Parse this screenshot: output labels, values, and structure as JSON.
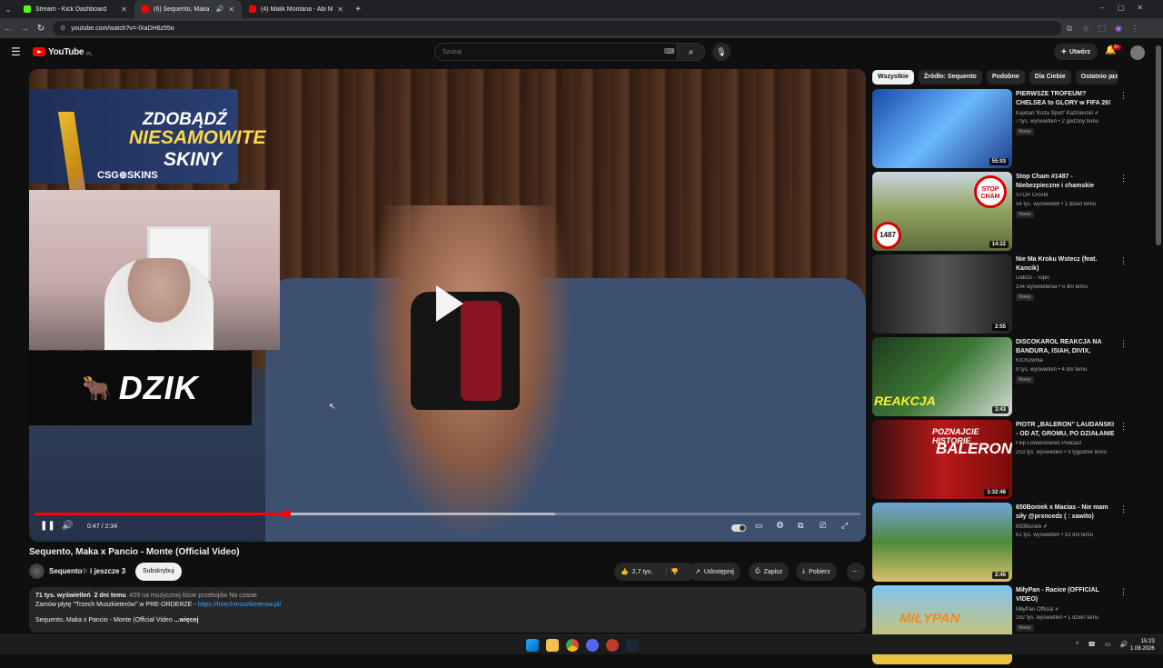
{
  "browser": {
    "tabs": [
      {
        "title": "Stream - Kick Dashboard",
        "favicon_color": "#53fc18",
        "active": false
      },
      {
        "title": "(6) Sequento, Maka x Panc",
        "favicon_color": "#ff0000",
        "active": true
      },
      {
        "title": "(4) Malik Montana - Abi Mosa",
        "favicon_color": "#ff0000",
        "active": false
      }
    ],
    "new_tab": "+",
    "url": "youtube.com/watch?v=-lXaDH6z55o"
  },
  "header": {
    "logo_text": "YouTube",
    "logo_region": "PL",
    "search_placeholder": "Szukaj",
    "create_label": "Utwórz",
    "notif_count": "9+"
  },
  "player": {
    "ad": {
      "line1": "ZDOBĄDŹ",
      "line2": "NIESAMOWITE",
      "line3": "SKINY",
      "brand": "CSG⊕SKINS"
    },
    "sponsor": "DZIK",
    "time": "0:47 / 2:34",
    "progress_fraction": 0.305,
    "buffered_fraction": 0.63
  },
  "video": {
    "title": "Sequento, Maka x Pancio - Monte (Official Video)",
    "channel": "Sequento",
    "channel_more": "i jeszcze 3",
    "subscribe_label": "Subskrybuj",
    "likes": "2,7 tys.",
    "share_label": "Udostępnij",
    "save_label": "Zapisz",
    "download_label": "Pobierz",
    "desc_views": "71 tys. wyświetleń",
    "desc_date": "2 dni temu",
    "desc_tags": "#29 na muzycznej liście przebojów Na czasie",
    "desc_line2_prefix": "Zamów płytę \"Trzech Muszkieterów\" w PRE-ORDERZE - ",
    "desc_link": "https://trzechmuszkieterow.pl/",
    "desc_line3": "Sequento, Maka x Pancio - Monte (Official Video",
    "desc_more": "...więcej"
  },
  "chips": [
    "Wszystkie",
    "Źródło: Sequento",
    "Podobne",
    "Dla Ciebie",
    "Ostatnio prz"
  ],
  "recommendations": [
    {
      "title": "PIERWSZE TROFEUM? CHELSEA to GLORY w FIFA 26!",
      "channel": "Kajetan 'Koza Sport' Kaźmierski ✔",
      "meta": "7 tys. wyświetleń • 2 godziny temu",
      "badge": "Nowy",
      "duration": "55:03",
      "thumb_bg": "linear-gradient(135deg,#1a4aa8,#6bb8ff,#1d3f8c)"
    },
    {
      "title": "Stop Cham #1487 - Niebezpieczne i chamskie sytuacje na drogach",
      "channel": "STOP CHAM",
      "meta": "54 tys. wyświetleń • 1 dzień temu",
      "badge": "Nowy",
      "duration": "14:22",
      "thumb_bg": "linear-gradient(180deg,#c9d6e0,#8fa35e,#5d6b3b)"
    },
    {
      "title": "Nie Ma Kroku Wstecz (feat. Kancik)",
      "channel": "DaBzu - Topic",
      "meta": "154 wyświetlenia • 5 dni temu",
      "badge": "Nowy",
      "duration": "2:55",
      "thumb_bg": "linear-gradient(90deg,#222,#555,#222)"
    },
    {
      "title": "DISCOKAROL REAKCJA NA BANDURA, ISIAH, DIVIX, MACIAS...",
      "channel": "KICKownia",
      "meta": "9 tys. wyświetleń • 4 dni temu",
      "badge": "Nowy",
      "duration": "3:43",
      "thumb_bg": "linear-gradient(135deg,#1d3b1d,#3e7a36,#d8dcd8)"
    },
    {
      "title": "PIOTR „BALERON” LAUDAŃSKI - OD AT, GROMU, PO DZIAŁANIE Z ...",
      "channel": "Filip Lewandowski Podcast",
      "meta": "253 tys. wyświetleń • 3 tygodnie temu",
      "badge": "",
      "duration": "1:32:48",
      "thumb_bg": "linear-gradient(90deg,#3a1010,#b81818,#7a0c0c)"
    },
    {
      "title": "650Boniek x Macias - Nie mam siły @prxncedz ( : xawito)",
      "channel": "650Boniek ✔",
      "meta": "61 tys. wyświetleń • 10 dni temu",
      "badge": "",
      "duration": "2:45",
      "thumb_bg": "linear-gradient(180deg,#6fa3d6,#4e8a3a,#d9c26a)"
    },
    {
      "title": "MiłyPan - Racice (OFFICIAL VIDEO)",
      "channel": "MiłyPan Official ✔",
      "meta": "162 tys. wyświetleń • 1 dzień temu",
      "badge": "Nowy",
      "duration": "",
      "thumb_bg": "linear-gradient(180deg,#7fc4ef,#f2c33a)"
    }
  ],
  "rec_texts": {
    "stop": "STOP CHAM",
    "num": "1487",
    "reakcja": "REAKCJA",
    "poznajcie": "POZNAJCIE HISTORIE",
    "balerona": "BALERONA",
    "milypan": "MIŁYPAN"
  },
  "taskbar": {
    "time": "15:23",
    "date": "1.08.2026"
  }
}
